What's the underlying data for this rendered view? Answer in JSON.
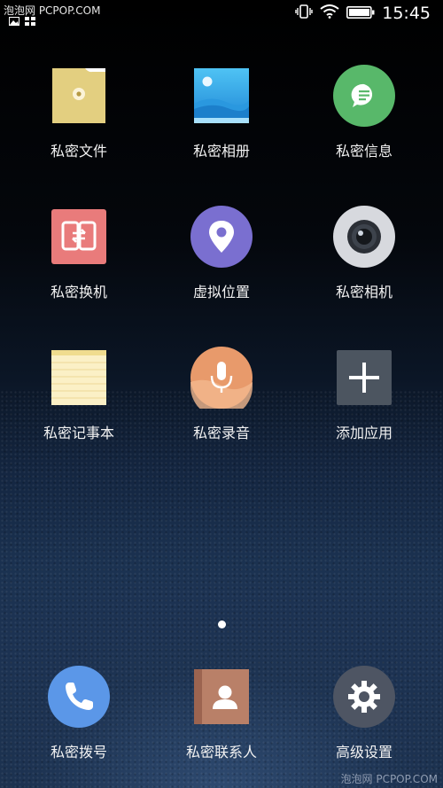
{
  "status_bar": {
    "watermark": "泡泡网 PCPOP.COM",
    "time": "15:45",
    "icons": [
      "image-icon",
      "grid-icon",
      "vibrate-icon",
      "wifi-icon",
      "battery-icon"
    ]
  },
  "apps": [
    {
      "label": "私密文件",
      "icon": "folder-icon"
    },
    {
      "label": "私密相册",
      "icon": "photo-album-icon"
    },
    {
      "label": "私密信息",
      "icon": "message-icon"
    },
    {
      "label": "私密换机",
      "icon": "phone-transfer-icon"
    },
    {
      "label": "虚拟位置",
      "icon": "location-pin-icon"
    },
    {
      "label": "私密相机",
      "icon": "camera-icon"
    },
    {
      "label": "私密记事本",
      "icon": "notepad-icon"
    },
    {
      "label": "私密录音",
      "icon": "microphone-icon"
    },
    {
      "label": "添加应用",
      "icon": "add-icon"
    }
  ],
  "dock": [
    {
      "label": "私密拨号",
      "icon": "phone-icon"
    },
    {
      "label": "私密联系人",
      "icon": "contacts-icon"
    },
    {
      "label": "高级设置",
      "icon": "gear-icon"
    }
  ],
  "footer": {
    "watermark": "泡泡网 PCPOP.COM"
  },
  "colors": {
    "folder": "#e3cf80",
    "album": "#3aa8e6",
    "message": "#58b86a",
    "transfer": "#e97b7b",
    "location": "#7a6fd0",
    "camera": "#d7d9de",
    "notepad": "#fbf0c6",
    "microphone": "#e89a6b",
    "add": "#4c5560",
    "phone": "#5b97e8",
    "contacts": "#b98068",
    "settings": "#4e5563"
  }
}
